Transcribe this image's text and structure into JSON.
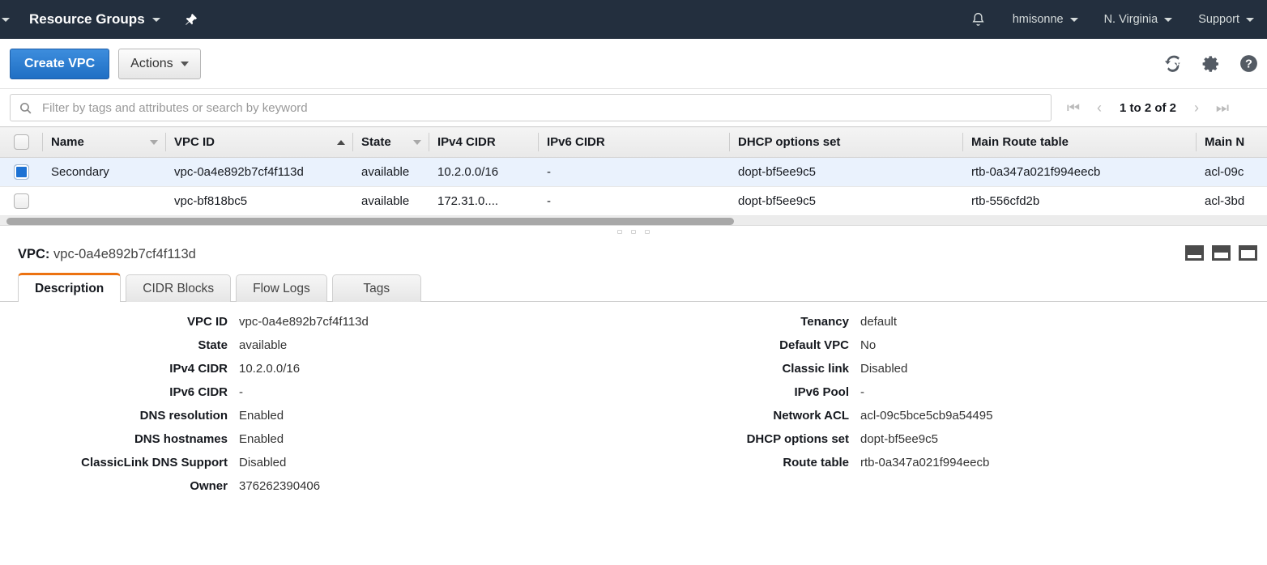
{
  "topnav": {
    "service_menu": "Resource Groups",
    "pin_icon": "pin-icon",
    "bell_icon": "bell-icon",
    "account": "hmisonne",
    "region": "N. Virginia",
    "support": "Support"
  },
  "toolbar": {
    "create_label": "Create VPC",
    "actions_label": "Actions",
    "refresh_icon": "refresh-icon",
    "settings_icon": "gear-icon",
    "help_icon": "help-icon"
  },
  "filter": {
    "placeholder": "Filter by tags and attributes or search by keyword",
    "value": "",
    "search_icon": "search-icon",
    "pagination": {
      "first": "|◀",
      "prev": "◀",
      "label": "1 to 2 of 2",
      "next": "▶",
      "last": "▶|"
    }
  },
  "table": {
    "columns": [
      {
        "label": "Name",
        "sort": "none"
      },
      {
        "label": "VPC ID",
        "sort": "asc"
      },
      {
        "label": "State",
        "sort": "none"
      },
      {
        "label": "IPv4 CIDR",
        "sort": null
      },
      {
        "label": "IPv6 CIDR",
        "sort": null
      },
      {
        "label": "DHCP options set",
        "sort": null
      },
      {
        "label": "Main Route table",
        "sort": null
      },
      {
        "label": "Main N",
        "sort": null
      }
    ],
    "rows": [
      {
        "selected": true,
        "name": "Secondary",
        "vpc_id": "vpc-0a4e892b7cf4f113d",
        "state": "available",
        "ipv4": "10.2.0.0/16",
        "ipv6": "-",
        "dhcp": "dopt-bf5ee9c5",
        "route_table": "rtb-0a347a021f994eecb",
        "acl": "acl-09c"
      },
      {
        "selected": false,
        "name": "",
        "vpc_id": "vpc-bf818bc5",
        "state": "available",
        "ipv4": "172.31.0....",
        "ipv6": "-",
        "dhcp": "dopt-bf5ee9c5",
        "route_table": "rtb-556cfd2b",
        "acl": "acl-3bd"
      }
    ]
  },
  "detail": {
    "title_label": "VPC:",
    "title_value": "vpc-0a4e892b7cf4f113d",
    "tabs": [
      {
        "label": "Description",
        "active": true
      },
      {
        "label": "CIDR Blocks",
        "active": false
      },
      {
        "label": "Flow Logs",
        "active": false
      },
      {
        "label": "Tags",
        "active": false
      }
    ],
    "left_fields": [
      {
        "label": "VPC ID",
        "value": "vpc-0a4e892b7cf4f113d",
        "style": "plain"
      },
      {
        "label": "State",
        "value": "available",
        "style": "state"
      },
      {
        "label": "IPv4 CIDR",
        "value": "10.2.0.0/16",
        "style": "plain"
      },
      {
        "label": "IPv6 CIDR",
        "value": "-",
        "style": "plain"
      },
      {
        "label": "DNS resolution",
        "value": "Enabled",
        "style": "plain"
      },
      {
        "label": "DNS hostnames",
        "value": "Enabled",
        "style": "plain"
      },
      {
        "label": "ClassicLink DNS Support",
        "value": "Disabled",
        "style": "plain"
      },
      {
        "label": "Owner",
        "value": "376262390406",
        "style": "plain"
      }
    ],
    "right_fields": [
      {
        "label": "Tenancy",
        "value": "default",
        "style": "plain"
      },
      {
        "label": "Default VPC",
        "value": "No",
        "style": "plain"
      },
      {
        "label": "Classic link",
        "value": "Disabled",
        "style": "plain"
      },
      {
        "label": "IPv6 Pool",
        "value": "-",
        "style": "plain"
      },
      {
        "label": "Network ACL",
        "value": "acl-09c5bce5cb9a54495",
        "style": "link"
      },
      {
        "label": "DHCP options set",
        "value": "dopt-bf5ee9c5",
        "style": "link"
      },
      {
        "label": "Route table",
        "value": "rtb-0a347a021f994eecb",
        "style": "link"
      }
    ],
    "layout_icons": [
      "panel-small-icon",
      "panel-medium-icon",
      "panel-large-icon"
    ]
  },
  "colors": {
    "nav_bg": "#232f3e",
    "accent_orange": "#ec7211",
    "link_blue": "#0073bb",
    "state_green": "#1d8102",
    "primary_blue": "#1f6fc4",
    "row_selected": "#eaf2fd"
  }
}
